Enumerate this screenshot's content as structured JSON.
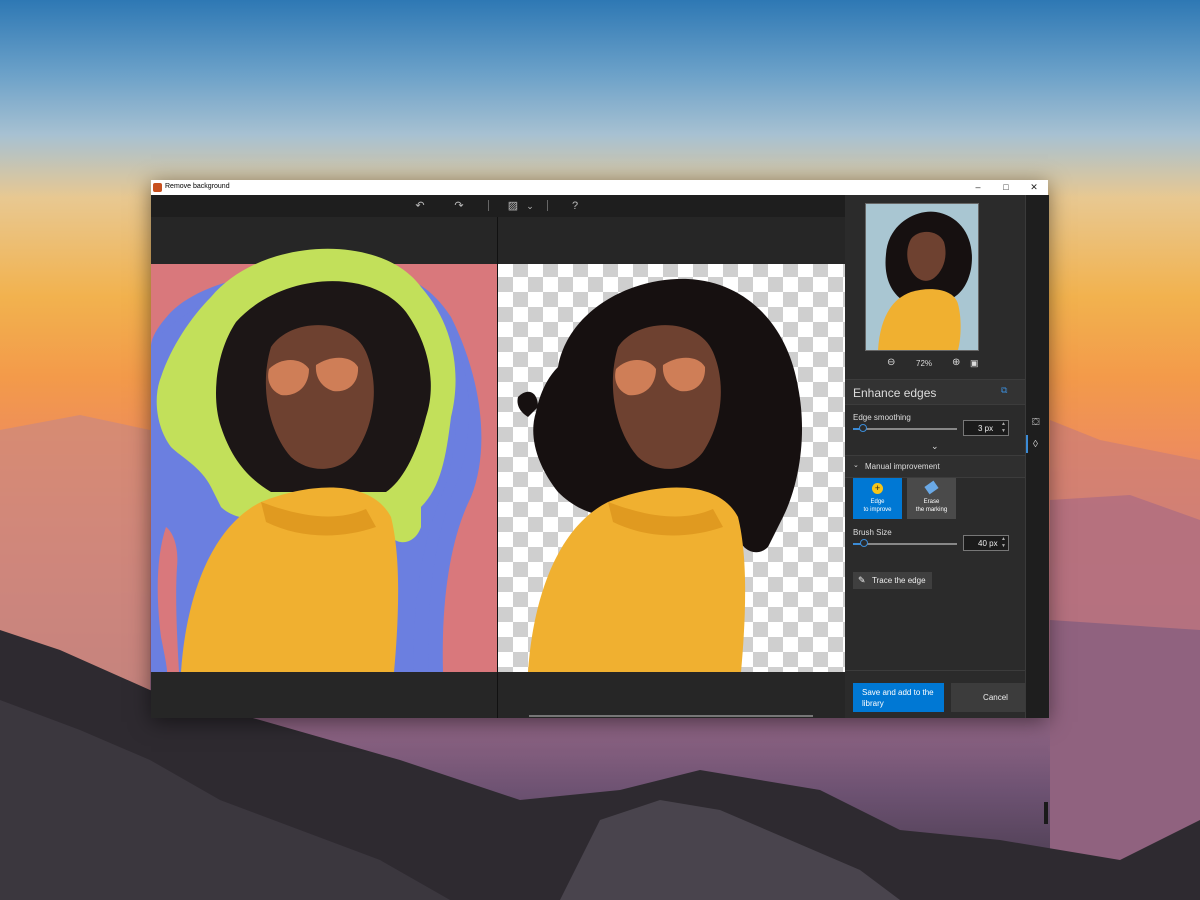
{
  "window": {
    "title": "Remove background",
    "controls": {
      "minimize": "–",
      "maximize": "□",
      "close": "✕"
    }
  },
  "toolbar": {
    "undo": "↶",
    "redo": "↷",
    "view_icon": "▨",
    "view_dropdown": "⌄",
    "help": "?"
  },
  "thumbnail": {
    "zoom_level": "72%"
  },
  "enhance_edges": {
    "title": "Enhance edges",
    "edge_smoothing_label": "Edge smoothing",
    "edge_smoothing_value": "3 px",
    "edge_smoothing_level": 0.1,
    "expand_chevron": "⌄"
  },
  "manual_improvement": {
    "title": "Manual improvement",
    "edge_improve_line1": "Edge",
    "edge_improve_line2": "to improve",
    "erase_line1": "Erase",
    "erase_line2": "the marking",
    "brush_size_label": "Brush Size",
    "brush_size_value": "40 px",
    "brush_size_level": 0.1,
    "trace_label": "Trace the edge"
  },
  "actions": {
    "save_line1": "Save and add to the",
    "save_line2": "library",
    "cancel": "Cancel"
  },
  "colors": {
    "accent": "#0078d4",
    "mark_red": "#d9787c",
    "mark_blue": "#6b7fe0",
    "mark_green": "#c2e05a",
    "sweater": "#f0b030"
  }
}
